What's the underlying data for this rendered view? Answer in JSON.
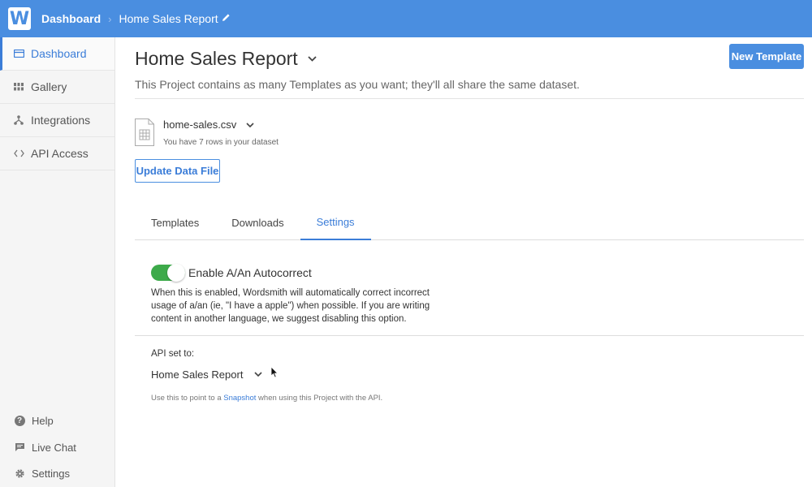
{
  "topbar": {
    "logo_letter": "W",
    "breadcrumb_home": "Dashboard",
    "breadcrumb_separator": "›",
    "breadcrumb_current": "Home Sales Report",
    "edit_icon": "pencil-icon",
    "bg_color": "#4a8ee0"
  },
  "sidebar": {
    "items": [
      {
        "label": "Dashboard",
        "icon": "dashboard-icon",
        "active": true
      },
      {
        "label": "Gallery",
        "icon": "grid-icon",
        "active": false
      },
      {
        "label": "Integrations",
        "icon": "integrations-icon",
        "active": false
      },
      {
        "label": "API Access",
        "icon": "code-icon",
        "active": false
      }
    ],
    "bottom_items": [
      {
        "label": "Help",
        "icon": "help-icon"
      },
      {
        "label": "Live Chat",
        "icon": "chat-icon"
      },
      {
        "label": "Settings",
        "icon": "gear-icon"
      }
    ]
  },
  "main": {
    "title": "Home Sales Report",
    "subtitle": "This Project contains as many Templates as you want; they'll all share the same dataset.",
    "new_template_label": "New Template",
    "file": {
      "name": "home-sales.csv",
      "rows_note": "You have 7 rows in your dataset"
    },
    "update_button_label": "Update Data File",
    "tabs": [
      {
        "label": "Templates",
        "active": false
      },
      {
        "label": "Downloads",
        "active": false
      },
      {
        "label": "Settings",
        "active": true
      }
    ],
    "settings": {
      "autocorrect": {
        "label": "Enable A/An Autocorrect",
        "enabled": true,
        "description": "When this is enabled, Wordsmith will automatically correct incorrect usage of a/an (ie, \"I have a apple\") when possible. If you are writing content in another language, we suggest disabling this option."
      },
      "api": {
        "label": "API set to:",
        "value": "Home Sales Report",
        "note_before": "Use this to point to a ",
        "note_link": "Snapshot",
        "note_after": " when using this Project with the API."
      }
    }
  },
  "colors": {
    "accent": "#3b7dd8",
    "toggle_on": "#3daa4a"
  }
}
